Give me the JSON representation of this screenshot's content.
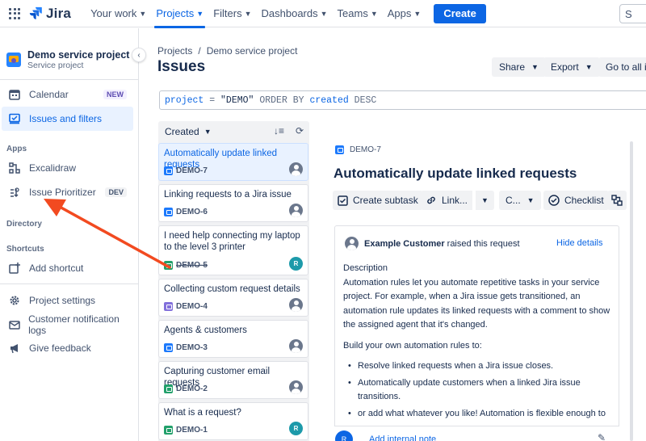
{
  "topnav": {
    "logo": "Jira",
    "items": [
      "Your work",
      "Projects",
      "Filters",
      "Dashboards",
      "Teams",
      "Apps"
    ],
    "active": "Projects",
    "create": "Create",
    "search_placeholder": "S"
  },
  "sidebar": {
    "project_name": "Demo service project",
    "project_type": "Service project",
    "calendar": "Calendar",
    "calendar_badge": "NEW",
    "issues_filters": "Issues and filters",
    "apps_heading": "Apps",
    "excalidraw": "Excalidraw",
    "issue_prioritizer": "Issue Prioritizer",
    "prioritizer_badge": "DEV",
    "directory_heading": "Directory",
    "shortcuts_heading": "Shortcuts",
    "add_shortcut": "Add shortcut",
    "project_settings": "Project settings",
    "notification_logs": "Customer notification logs",
    "give_feedback": "Give feedback"
  },
  "header": {
    "breadcrumb": [
      "Projects",
      "Demo service project"
    ],
    "title": "Issues",
    "share": "Share",
    "export": "Export",
    "go_to_all": "Go to all is"
  },
  "jql": {
    "parts": [
      "project",
      " = ",
      "\"DEMO\"",
      " ORDER BY ",
      "created",
      " DESC"
    ]
  },
  "list": {
    "sort_label": "Created",
    "issues": [
      {
        "title": "Automatically update linked requests",
        "key": "DEMO-7",
        "type": "blue",
        "avatar": "gray",
        "strike": false
      },
      {
        "title": "Linking requests to a Jira issue",
        "key": "DEMO-6",
        "type": "blue",
        "avatar": "gray",
        "strike": false
      },
      {
        "title": "I need help connecting my laptop to the level 3 printer",
        "key": "DEMO-5",
        "type": "green",
        "avatar": "R",
        "strike": true
      },
      {
        "title": "Collecting custom request details",
        "key": "DEMO-4",
        "type": "purple",
        "avatar": "gray",
        "strike": false
      },
      {
        "title": "Agents & customers",
        "key": "DEMO-3",
        "type": "blue",
        "avatar": "gray",
        "strike": false
      },
      {
        "title": "Capturing customer email requests",
        "key": "DEMO-2",
        "type": "green",
        "avatar": "gray",
        "strike": false
      },
      {
        "title": "What is a request?",
        "key": "DEMO-1",
        "type": "green",
        "avatar": "R",
        "strike": false
      }
    ]
  },
  "detail": {
    "key": "DEMO-7",
    "title": "Automatically update linked requests",
    "actions": {
      "create_subtask": "Create subtask",
      "link": "Link...",
      "c": "C...",
      "checklist": "Checklist"
    },
    "requester": "Example Customer",
    "raised": "raised this request",
    "hide_details": "Hide details",
    "description_label": "Description",
    "description": "Automation rules let you automate repetitive tasks in your service project. For example, when a Jira issue gets transitioned, an automation rule updates its linked requests with a comment to show the assigned agent that it's changed.",
    "build_intro": "Build your own automation rules to:",
    "bullets": [
      "Resolve linked requests when a Jira issue closes.",
      "Automatically update customers when a linked Jira issue transitions.",
      "or add what whatever you like! Automation is flexible enough to"
    ],
    "note_avatar": "R",
    "add_internal_note": "Add internal note"
  },
  "colors": {
    "brand": "#0c66e4",
    "annotation_arrow": "#f24a20"
  }
}
